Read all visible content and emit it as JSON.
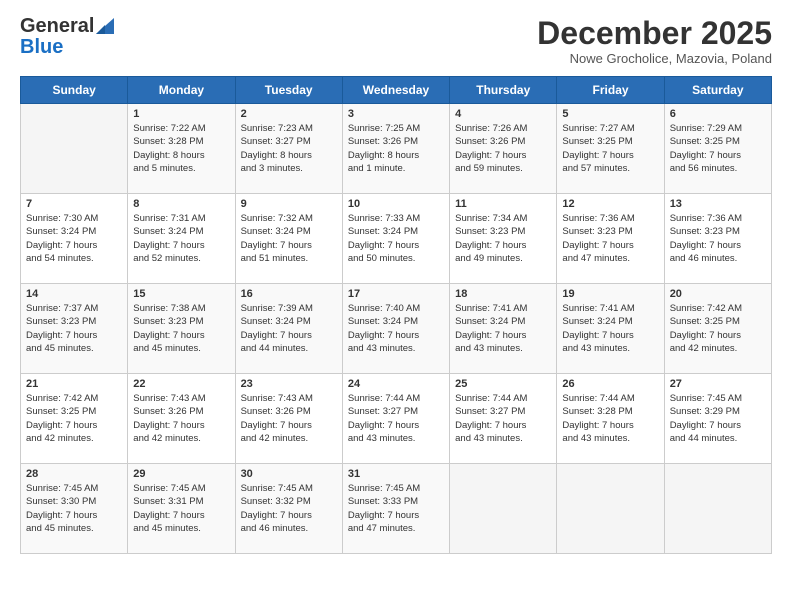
{
  "header": {
    "logo_general": "General",
    "logo_blue": "Blue",
    "month_title": "December 2025",
    "subtitle": "Nowe Grocholice, Mazovia, Poland"
  },
  "days_of_week": [
    "Sunday",
    "Monday",
    "Tuesday",
    "Wednesday",
    "Thursday",
    "Friday",
    "Saturday"
  ],
  "weeks": [
    [
      {
        "day": "",
        "info": ""
      },
      {
        "day": "1",
        "info": "Sunrise: 7:22 AM\nSunset: 3:28 PM\nDaylight: 8 hours\nand 5 minutes."
      },
      {
        "day": "2",
        "info": "Sunrise: 7:23 AM\nSunset: 3:27 PM\nDaylight: 8 hours\nand 3 minutes."
      },
      {
        "day": "3",
        "info": "Sunrise: 7:25 AM\nSunset: 3:26 PM\nDaylight: 8 hours\nand 1 minute."
      },
      {
        "day": "4",
        "info": "Sunrise: 7:26 AM\nSunset: 3:26 PM\nDaylight: 7 hours\nand 59 minutes."
      },
      {
        "day": "5",
        "info": "Sunrise: 7:27 AM\nSunset: 3:25 PM\nDaylight: 7 hours\nand 57 minutes."
      },
      {
        "day": "6",
        "info": "Sunrise: 7:29 AM\nSunset: 3:25 PM\nDaylight: 7 hours\nand 56 minutes."
      }
    ],
    [
      {
        "day": "7",
        "info": "Sunrise: 7:30 AM\nSunset: 3:24 PM\nDaylight: 7 hours\nand 54 minutes."
      },
      {
        "day": "8",
        "info": "Sunrise: 7:31 AM\nSunset: 3:24 PM\nDaylight: 7 hours\nand 52 minutes."
      },
      {
        "day": "9",
        "info": "Sunrise: 7:32 AM\nSunset: 3:24 PM\nDaylight: 7 hours\nand 51 minutes."
      },
      {
        "day": "10",
        "info": "Sunrise: 7:33 AM\nSunset: 3:24 PM\nDaylight: 7 hours\nand 50 minutes."
      },
      {
        "day": "11",
        "info": "Sunrise: 7:34 AM\nSunset: 3:23 PM\nDaylight: 7 hours\nand 49 minutes."
      },
      {
        "day": "12",
        "info": "Sunrise: 7:36 AM\nSunset: 3:23 PM\nDaylight: 7 hours\nand 47 minutes."
      },
      {
        "day": "13",
        "info": "Sunrise: 7:36 AM\nSunset: 3:23 PM\nDaylight: 7 hours\nand 46 minutes."
      }
    ],
    [
      {
        "day": "14",
        "info": "Sunrise: 7:37 AM\nSunset: 3:23 PM\nDaylight: 7 hours\nand 45 minutes."
      },
      {
        "day": "15",
        "info": "Sunrise: 7:38 AM\nSunset: 3:23 PM\nDaylight: 7 hours\nand 45 minutes."
      },
      {
        "day": "16",
        "info": "Sunrise: 7:39 AM\nSunset: 3:24 PM\nDaylight: 7 hours\nand 44 minutes."
      },
      {
        "day": "17",
        "info": "Sunrise: 7:40 AM\nSunset: 3:24 PM\nDaylight: 7 hours\nand 43 minutes."
      },
      {
        "day": "18",
        "info": "Sunrise: 7:41 AM\nSunset: 3:24 PM\nDaylight: 7 hours\nand 43 minutes."
      },
      {
        "day": "19",
        "info": "Sunrise: 7:41 AM\nSunset: 3:24 PM\nDaylight: 7 hours\nand 43 minutes."
      },
      {
        "day": "20",
        "info": "Sunrise: 7:42 AM\nSunset: 3:25 PM\nDaylight: 7 hours\nand 42 minutes."
      }
    ],
    [
      {
        "day": "21",
        "info": "Sunrise: 7:42 AM\nSunset: 3:25 PM\nDaylight: 7 hours\nand 42 minutes."
      },
      {
        "day": "22",
        "info": "Sunrise: 7:43 AM\nSunset: 3:26 PM\nDaylight: 7 hours\nand 42 minutes."
      },
      {
        "day": "23",
        "info": "Sunrise: 7:43 AM\nSunset: 3:26 PM\nDaylight: 7 hours\nand 42 minutes."
      },
      {
        "day": "24",
        "info": "Sunrise: 7:44 AM\nSunset: 3:27 PM\nDaylight: 7 hours\nand 43 minutes."
      },
      {
        "day": "25",
        "info": "Sunrise: 7:44 AM\nSunset: 3:27 PM\nDaylight: 7 hours\nand 43 minutes."
      },
      {
        "day": "26",
        "info": "Sunrise: 7:44 AM\nSunset: 3:28 PM\nDaylight: 7 hours\nand 43 minutes."
      },
      {
        "day": "27",
        "info": "Sunrise: 7:45 AM\nSunset: 3:29 PM\nDaylight: 7 hours\nand 44 minutes."
      }
    ],
    [
      {
        "day": "28",
        "info": "Sunrise: 7:45 AM\nSunset: 3:30 PM\nDaylight: 7 hours\nand 45 minutes."
      },
      {
        "day": "29",
        "info": "Sunrise: 7:45 AM\nSunset: 3:31 PM\nDaylight: 7 hours\nand 45 minutes."
      },
      {
        "day": "30",
        "info": "Sunrise: 7:45 AM\nSunset: 3:32 PM\nDaylight: 7 hours\nand 46 minutes."
      },
      {
        "day": "31",
        "info": "Sunrise: 7:45 AM\nSunset: 3:33 PM\nDaylight: 7 hours\nand 47 minutes."
      },
      {
        "day": "",
        "info": ""
      },
      {
        "day": "",
        "info": ""
      },
      {
        "day": "",
        "info": ""
      }
    ]
  ]
}
